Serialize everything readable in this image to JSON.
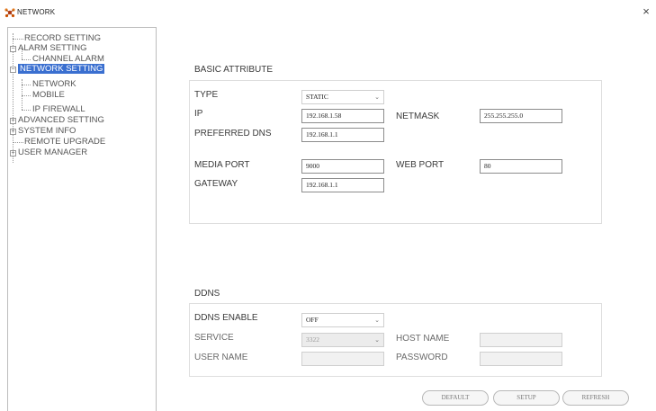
{
  "window": {
    "title": "NETWORK",
    "close_glyph": "×"
  },
  "tree": {
    "record_setting": "RECORD SETTING",
    "alarm_setting": "ALARM SETTING",
    "channel_alarm": "CHANNEL ALARM",
    "network_setting": "NETWORK SETTING",
    "network": "NETWORK",
    "mobile": "MOBILE",
    "ip_firewall": "IP FIREWALL",
    "advanced_setting": "ADVANCED SETTING",
    "system_info": "SYSTEM INFO",
    "remote_upgrade": "REMOTE UPGRADE",
    "user_manager": "USER MANAGER",
    "expand_glyph": "+",
    "collapse_glyph": "−"
  },
  "basic": {
    "title": "BASIC ATTRIBUTE",
    "type_label": "TYPE",
    "type_value": "STATIC",
    "ip_label": "IP",
    "ip_value": "192.168.1.58",
    "netmask_label": "NETMASK",
    "netmask_value": "255.255.255.0",
    "dns_label": "PREFERRED DNS",
    "dns_value": "192.168.1.1",
    "media_port_label": "MEDIA PORT",
    "media_port_value": "9000",
    "web_port_label": "WEB PORT",
    "web_port_value": "80",
    "gateway_label": "GATEWAY",
    "gateway_value": "192.168.1.1"
  },
  "ddns": {
    "title": "DDNS",
    "enable_label": "DDNS ENABLE",
    "enable_value": "OFF",
    "service_label": "SERVICE",
    "service_value": "3322",
    "host_name_label": "HOST NAME",
    "user_name_label": "USER NAME",
    "password_label": "PASSWORD"
  },
  "buttons": {
    "default": "DEFAULT",
    "setup": "SETUP",
    "refresh": "REFRESH"
  },
  "dropdown_glyph": "⌄",
  "colors": {
    "selection": "#3a6fd0",
    "border": "#bdbdbd"
  }
}
